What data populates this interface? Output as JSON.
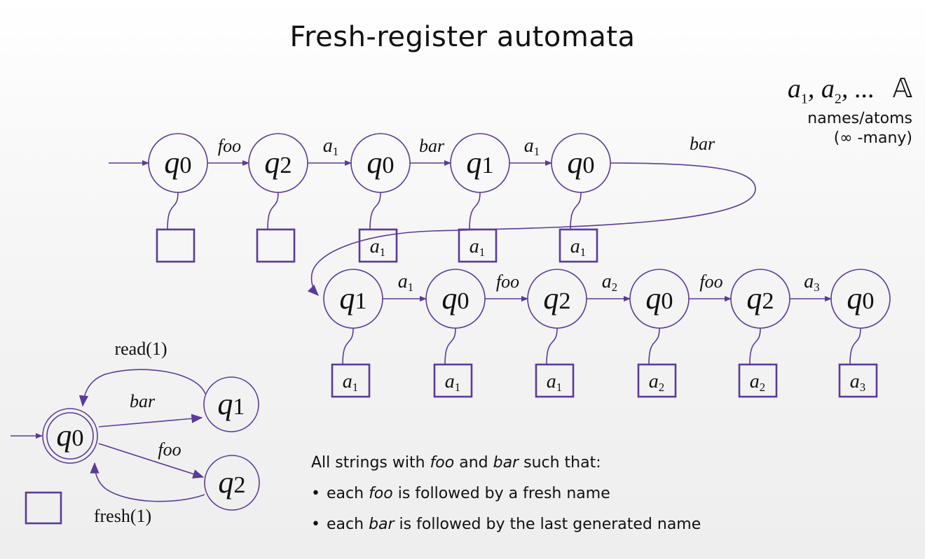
{
  "title": "Fresh-register automata",
  "atoms": {
    "names": [
      {
        "base": "a",
        "sub": "1"
      },
      {
        "base": "a",
        "sub": "2"
      }
    ],
    "ellipsis": "...",
    "set_symbol": "𝔸",
    "caption_line1": "names/atoms",
    "caption_line2": "(∞ -many)"
  },
  "colors": {
    "accent": "#5b3a9a",
    "text": "#111111"
  },
  "run_top": {
    "states": [
      "q0",
      "q2",
      "q0",
      "q1",
      "q0"
    ],
    "registers": [
      "",
      "",
      "a1",
      "a1",
      "a1"
    ],
    "transitions": [
      "foo",
      "a1",
      "bar",
      "a1"
    ],
    "wrap_label": "bar"
  },
  "run_bottom": {
    "states": [
      "q1",
      "q0",
      "q2",
      "q0",
      "q2",
      "q0"
    ],
    "registers": [
      "a1",
      "a1",
      "a1",
      "a2",
      "a2",
      "a3"
    ],
    "transitions": [
      "a1",
      "foo",
      "a2",
      "foo",
      "a3"
    ]
  },
  "automaton": {
    "states": [
      "q0",
      "q1",
      "q2"
    ],
    "initial": "q0",
    "accepting": "q0",
    "edges": [
      {
        "from": "q0",
        "to": "q1",
        "label": "bar"
      },
      {
        "from": "q0",
        "to": "q2",
        "label": "foo"
      },
      {
        "from": "q1",
        "to": "q0",
        "label": "read(1)"
      },
      {
        "from": "q2",
        "to": "q0",
        "label": "fresh(1)"
      }
    ],
    "register_count": 1
  },
  "description": {
    "intro": [
      "All strings with ",
      "foo",
      " and ",
      "bar",
      " such that:"
    ],
    "bullets": [
      [
        "each ",
        "foo",
        " is followed by a fresh name"
      ],
      [
        "each ",
        "bar",
        " is followed by the last generated name"
      ]
    ],
    "bullet_glyph": "•"
  }
}
